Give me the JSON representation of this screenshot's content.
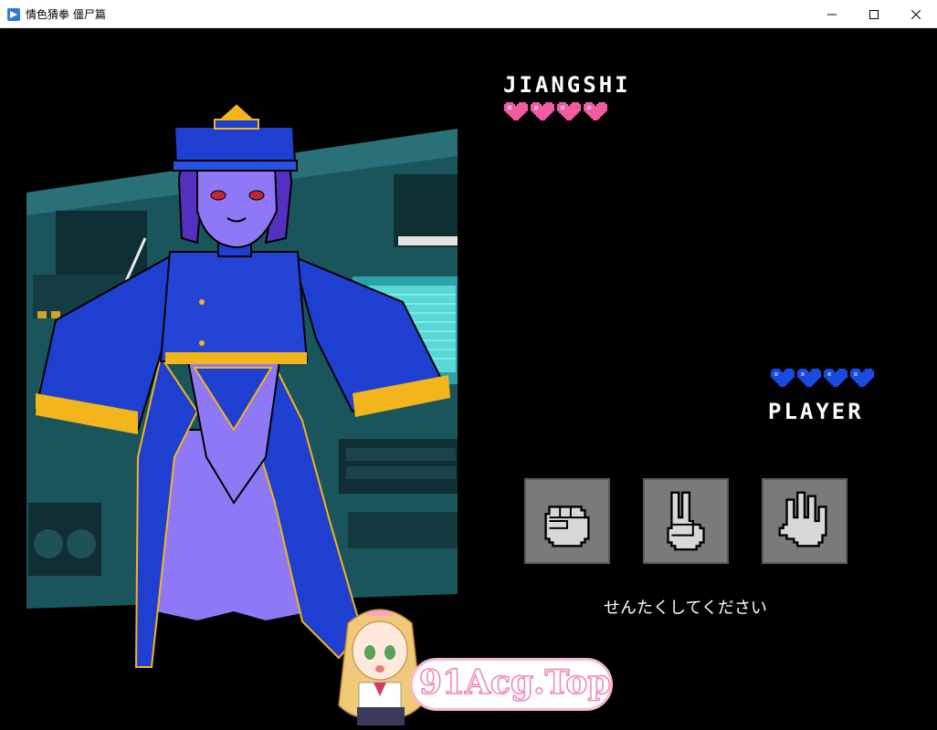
{
  "window": {
    "title": "情色猜拳 僵尸篇",
    "icon": "app-icon",
    "controls": [
      "minimize-icon",
      "maximize-icon",
      "close-icon"
    ]
  },
  "enemy": {
    "name": "JIANGSHI",
    "hearts": 4,
    "heart_color": "#f25ba0"
  },
  "player": {
    "name": "PLAYER",
    "hearts": 4,
    "heart_color": "#1a4be0"
  },
  "choices": [
    {
      "icon": "rock-fist-icon"
    },
    {
      "icon": "scissors-hand-icon"
    },
    {
      "icon": "paper-hand-icon"
    }
  ],
  "prompt": "せんたくしてください",
  "watermark": "91Acg.Top",
  "colors": {
    "background": "#000000",
    "outfit": "#1f3fd0",
    "skin": "#8f78f5",
    "trim": "#f2b51c",
    "room": "#1e5d63"
  }
}
